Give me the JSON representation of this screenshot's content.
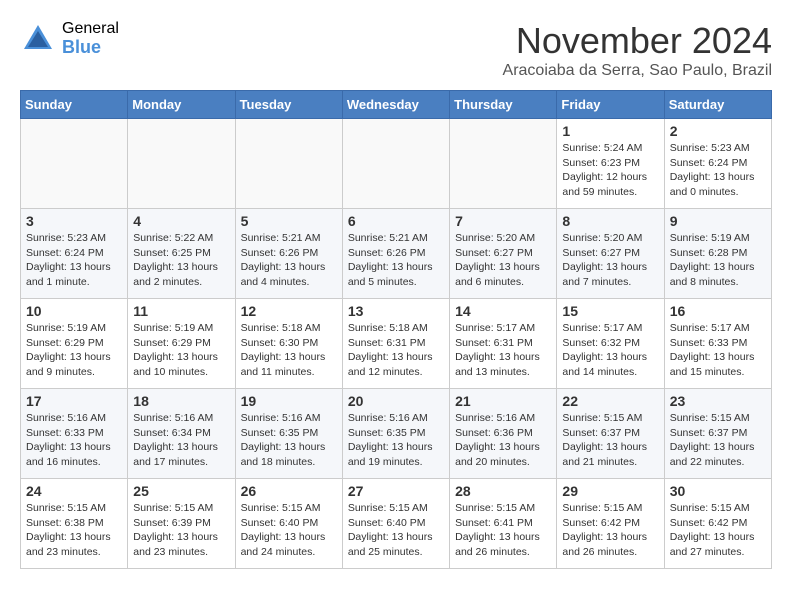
{
  "logo": {
    "general": "General",
    "blue": "Blue"
  },
  "title": "November 2024",
  "subtitle": "Aracoiaba da Serra, Sao Paulo, Brazil",
  "days_of_week": [
    "Sunday",
    "Monday",
    "Tuesday",
    "Wednesday",
    "Thursday",
    "Friday",
    "Saturday"
  ],
  "weeks": [
    [
      {
        "day": "",
        "info": ""
      },
      {
        "day": "",
        "info": ""
      },
      {
        "day": "",
        "info": ""
      },
      {
        "day": "",
        "info": ""
      },
      {
        "day": "",
        "info": ""
      },
      {
        "day": "1",
        "info": "Sunrise: 5:24 AM\nSunset: 6:23 PM\nDaylight: 12 hours and 59 minutes."
      },
      {
        "day": "2",
        "info": "Sunrise: 5:23 AM\nSunset: 6:24 PM\nDaylight: 13 hours and 0 minutes."
      }
    ],
    [
      {
        "day": "3",
        "info": "Sunrise: 5:23 AM\nSunset: 6:24 PM\nDaylight: 13 hours and 1 minute."
      },
      {
        "day": "4",
        "info": "Sunrise: 5:22 AM\nSunset: 6:25 PM\nDaylight: 13 hours and 2 minutes."
      },
      {
        "day": "5",
        "info": "Sunrise: 5:21 AM\nSunset: 6:26 PM\nDaylight: 13 hours and 4 minutes."
      },
      {
        "day": "6",
        "info": "Sunrise: 5:21 AM\nSunset: 6:26 PM\nDaylight: 13 hours and 5 minutes."
      },
      {
        "day": "7",
        "info": "Sunrise: 5:20 AM\nSunset: 6:27 PM\nDaylight: 13 hours and 6 minutes."
      },
      {
        "day": "8",
        "info": "Sunrise: 5:20 AM\nSunset: 6:27 PM\nDaylight: 13 hours and 7 minutes."
      },
      {
        "day": "9",
        "info": "Sunrise: 5:19 AM\nSunset: 6:28 PM\nDaylight: 13 hours and 8 minutes."
      }
    ],
    [
      {
        "day": "10",
        "info": "Sunrise: 5:19 AM\nSunset: 6:29 PM\nDaylight: 13 hours and 9 minutes."
      },
      {
        "day": "11",
        "info": "Sunrise: 5:19 AM\nSunset: 6:29 PM\nDaylight: 13 hours and 10 minutes."
      },
      {
        "day": "12",
        "info": "Sunrise: 5:18 AM\nSunset: 6:30 PM\nDaylight: 13 hours and 11 minutes."
      },
      {
        "day": "13",
        "info": "Sunrise: 5:18 AM\nSunset: 6:31 PM\nDaylight: 13 hours and 12 minutes."
      },
      {
        "day": "14",
        "info": "Sunrise: 5:17 AM\nSunset: 6:31 PM\nDaylight: 13 hours and 13 minutes."
      },
      {
        "day": "15",
        "info": "Sunrise: 5:17 AM\nSunset: 6:32 PM\nDaylight: 13 hours and 14 minutes."
      },
      {
        "day": "16",
        "info": "Sunrise: 5:17 AM\nSunset: 6:33 PM\nDaylight: 13 hours and 15 minutes."
      }
    ],
    [
      {
        "day": "17",
        "info": "Sunrise: 5:16 AM\nSunset: 6:33 PM\nDaylight: 13 hours and 16 minutes."
      },
      {
        "day": "18",
        "info": "Sunrise: 5:16 AM\nSunset: 6:34 PM\nDaylight: 13 hours and 17 minutes."
      },
      {
        "day": "19",
        "info": "Sunrise: 5:16 AM\nSunset: 6:35 PM\nDaylight: 13 hours and 18 minutes."
      },
      {
        "day": "20",
        "info": "Sunrise: 5:16 AM\nSunset: 6:35 PM\nDaylight: 13 hours and 19 minutes."
      },
      {
        "day": "21",
        "info": "Sunrise: 5:16 AM\nSunset: 6:36 PM\nDaylight: 13 hours and 20 minutes."
      },
      {
        "day": "22",
        "info": "Sunrise: 5:15 AM\nSunset: 6:37 PM\nDaylight: 13 hours and 21 minutes."
      },
      {
        "day": "23",
        "info": "Sunrise: 5:15 AM\nSunset: 6:37 PM\nDaylight: 13 hours and 22 minutes."
      }
    ],
    [
      {
        "day": "24",
        "info": "Sunrise: 5:15 AM\nSunset: 6:38 PM\nDaylight: 13 hours and 23 minutes."
      },
      {
        "day": "25",
        "info": "Sunrise: 5:15 AM\nSunset: 6:39 PM\nDaylight: 13 hours and 23 minutes."
      },
      {
        "day": "26",
        "info": "Sunrise: 5:15 AM\nSunset: 6:40 PM\nDaylight: 13 hours and 24 minutes."
      },
      {
        "day": "27",
        "info": "Sunrise: 5:15 AM\nSunset: 6:40 PM\nDaylight: 13 hours and 25 minutes."
      },
      {
        "day": "28",
        "info": "Sunrise: 5:15 AM\nSunset: 6:41 PM\nDaylight: 13 hours and 26 minutes."
      },
      {
        "day": "29",
        "info": "Sunrise: 5:15 AM\nSunset: 6:42 PM\nDaylight: 13 hours and 26 minutes."
      },
      {
        "day": "30",
        "info": "Sunrise: 5:15 AM\nSunset: 6:42 PM\nDaylight: 13 hours and 27 minutes."
      }
    ]
  ]
}
